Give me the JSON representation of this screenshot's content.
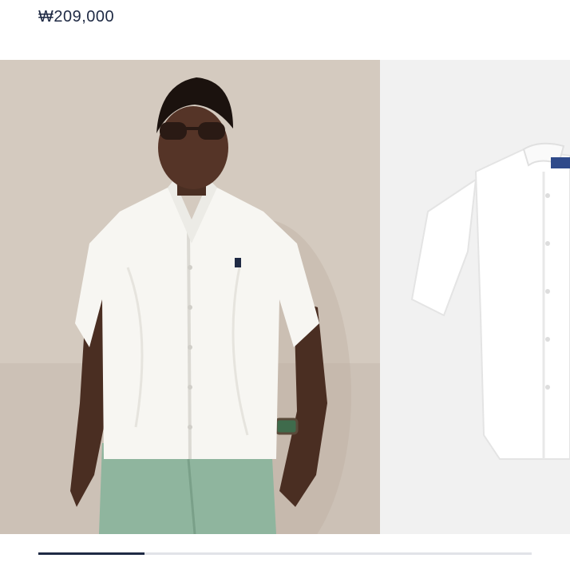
{
  "product": {
    "price": "₩209,000"
  },
  "gallery": {
    "slides": [
      {
        "description": "model-wearing-white-short-sleeve-shirt"
      },
      {
        "description": "white-short-sleeve-shirt-product-shot"
      }
    ],
    "progress": 0.215
  },
  "colors": {
    "price_text": "#1f2a44",
    "progress_fill": "#1f2a44",
    "progress_track": "#e1e3e8"
  }
}
